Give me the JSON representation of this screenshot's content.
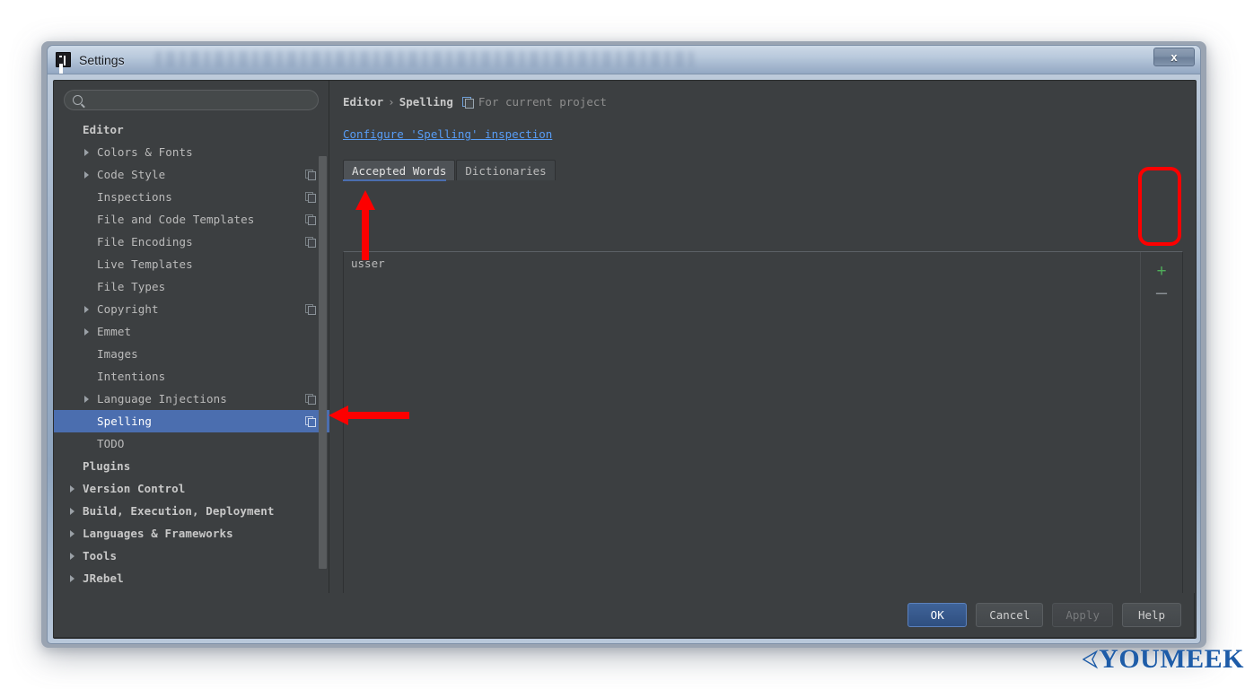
{
  "window": {
    "title": "Settings",
    "app_icon": "intellij-idea-icon",
    "close_label": "x"
  },
  "sidebar": {
    "search": {
      "value": "",
      "placeholder": "",
      "icon": "search-icon"
    },
    "items": [
      {
        "label": "Editor",
        "indent": 0,
        "bold": true,
        "expander": "none",
        "badge": false
      },
      {
        "label": "Colors & Fonts",
        "indent": 1,
        "bold": false,
        "expander": "collapsed",
        "badge": false
      },
      {
        "label": "Code Style",
        "indent": 1,
        "bold": false,
        "expander": "collapsed",
        "badge": true
      },
      {
        "label": "Inspections",
        "indent": 1,
        "bold": false,
        "expander": "none",
        "badge": true
      },
      {
        "label": "File and Code Templates",
        "indent": 1,
        "bold": false,
        "expander": "none",
        "badge": true
      },
      {
        "label": "File Encodings",
        "indent": 1,
        "bold": false,
        "expander": "none",
        "badge": true
      },
      {
        "label": "Live Templates",
        "indent": 1,
        "bold": false,
        "expander": "none",
        "badge": false
      },
      {
        "label": "File Types",
        "indent": 1,
        "bold": false,
        "expander": "none",
        "badge": false
      },
      {
        "label": "Copyright",
        "indent": 1,
        "bold": false,
        "expander": "collapsed",
        "badge": true
      },
      {
        "label": "Emmet",
        "indent": 1,
        "bold": false,
        "expander": "collapsed",
        "badge": false
      },
      {
        "label": "Images",
        "indent": 1,
        "bold": false,
        "expander": "none",
        "badge": false
      },
      {
        "label": "Intentions",
        "indent": 1,
        "bold": false,
        "expander": "none",
        "badge": false
      },
      {
        "label": "Language Injections",
        "indent": 1,
        "bold": false,
        "expander": "collapsed",
        "badge": true
      },
      {
        "label": "Spelling",
        "indent": 1,
        "bold": false,
        "expander": "none",
        "badge": true,
        "selected": true
      },
      {
        "label": "TODO",
        "indent": 1,
        "bold": false,
        "expander": "none",
        "badge": false
      },
      {
        "label": "Plugins",
        "indent": 0,
        "bold": true,
        "expander": "none",
        "badge": false
      },
      {
        "label": "Version Control",
        "indent": 0,
        "bold": true,
        "expander": "collapsed",
        "badge": false
      },
      {
        "label": "Build, Execution, Deployment",
        "indent": 0,
        "bold": true,
        "expander": "collapsed",
        "badge": false
      },
      {
        "label": "Languages & Frameworks",
        "indent": 0,
        "bold": true,
        "expander": "collapsed",
        "badge": false
      },
      {
        "label": "Tools",
        "indent": 0,
        "bold": true,
        "expander": "collapsed",
        "badge": false
      },
      {
        "label": "JRebel",
        "indent": 0,
        "bold": true,
        "expander": "collapsed",
        "badge": false
      }
    ]
  },
  "main": {
    "breadcrumb": {
      "root": "Editor",
      "separator": "›",
      "current": "Spelling"
    },
    "scope": {
      "icon": "project-scope-icon",
      "text": "For current project"
    },
    "configure_link": "Configure 'Spelling' inspection",
    "tabs": [
      {
        "label": "Accepted Words",
        "active": true
      },
      {
        "label": "Dictionaries",
        "active": false
      }
    ],
    "accepted_words": [
      "usser"
    ],
    "list_controls": [
      {
        "name": "add-word-button",
        "glyph": "+",
        "color": "#4fae5a"
      },
      {
        "name": "remove-word-button",
        "glyph": "–",
        "color": "#8b9095"
      }
    ]
  },
  "footer": {
    "buttons": [
      {
        "label": "OK",
        "style": "primary"
      },
      {
        "label": "Cancel",
        "style": "normal"
      },
      {
        "label": "Apply",
        "style": "disabled"
      },
      {
        "label": "Help",
        "style": "normal"
      }
    ]
  },
  "annotations": {
    "color": "#fd0000",
    "shapes": [
      {
        "name": "highlight-rect-add-remove",
        "kind": "rect"
      },
      {
        "name": "arrow-to-accepted-word",
        "kind": "arrow-up"
      },
      {
        "name": "arrow-to-spelling-item",
        "kind": "arrow-left"
      }
    ]
  },
  "watermark": {
    "text": "YOUMEEK",
    "color": "#1e5ca8"
  }
}
